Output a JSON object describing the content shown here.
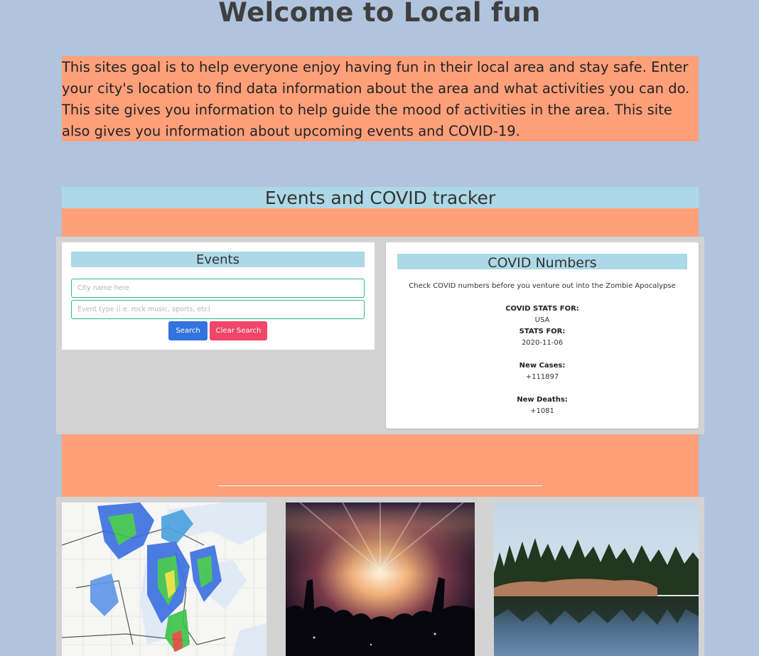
{
  "page": {
    "title": "Welcome to Local fun",
    "intro": "This sites goal is to help everyone enjoy having fun in their local area and stay safe. Enter your city's location to find data information about the area and what activities you can do. This site gives you information to help guide the mood of activities in the area. This site also gives you information about upcoming events and COVID-19."
  },
  "tracker": {
    "heading": "Events and COVID tracker"
  },
  "events": {
    "title": "Events",
    "city_placeholder": "City name here",
    "type_placeholder": "Event type (i.e. rock music, sports, etc)",
    "search_label": "Search",
    "clear_label": "Clear Search"
  },
  "covid": {
    "title": "COVID Numbers",
    "subtitle": "Check COVID numbers before you venture out into the Zombie Apocalypse",
    "stats_for_label": "COVID STATS FOR:",
    "stats_for_value": "USA",
    "date_label": "STATS FOR:",
    "date_value": "2020-11-06",
    "new_cases_label": "New Cases:",
    "new_cases_value": "+111897",
    "new_deaths_label": "New Deaths:",
    "new_deaths_value": "+1081"
  },
  "gallery": {
    "images": [
      "weather-radar-map",
      "concert-crowd",
      "lake-forest"
    ]
  },
  "colors": {
    "background": "#b0c4de",
    "accent": "#ffa07a",
    "heading_bg": "#add8e6",
    "search_button": "#3273dc",
    "clear_button": "#f14668",
    "input_border": "#27b88a"
  }
}
